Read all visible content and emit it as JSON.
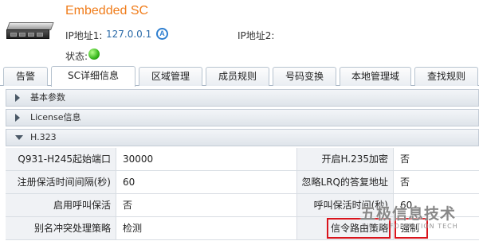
{
  "header": {
    "title": "Embedded SC",
    "ip1_label": "IP地址1:",
    "ip1_value": "127.0.0.1",
    "ip1_badge": "A",
    "ip2_label": "IP地址2:",
    "status_label": "状态:",
    "status_color": "#35b51a"
  },
  "tabs": [
    {
      "label": "告警"
    },
    {
      "label": "SC详细信息"
    },
    {
      "label": "区域管理"
    },
    {
      "label": "成员规则"
    },
    {
      "label": "号码变换"
    },
    {
      "label": "本地管理域"
    },
    {
      "label": "查找规则"
    }
  ],
  "active_tab": "SC详细信息",
  "sections": [
    {
      "label": "基本参数",
      "expanded": false
    },
    {
      "label": "License信息",
      "expanded": false
    },
    {
      "label": "H.323",
      "expanded": true
    }
  ],
  "h323": {
    "rows": [
      {
        "l1": "Q931-H245起始端口",
        "v1": "30000",
        "l2": "开启H.235加密",
        "v2": "否"
      },
      {
        "l1": "注册保活时间间隔(秒)",
        "v1": "60",
        "l2": "忽略LRQ的答复地址",
        "v2": "否"
      },
      {
        "l1": "启用呼叫保活",
        "v1": "否",
        "l2": "呼叫保活时间(秒)",
        "v2": "60"
      },
      {
        "l1": "别名冲突处理策略",
        "v1": "检测",
        "l2": "信令路由策略",
        "v2": "强制"
      }
    ]
  },
  "watermark": {
    "cn": "五极信息技术",
    "en": "WULIINFORMATION TECH"
  }
}
